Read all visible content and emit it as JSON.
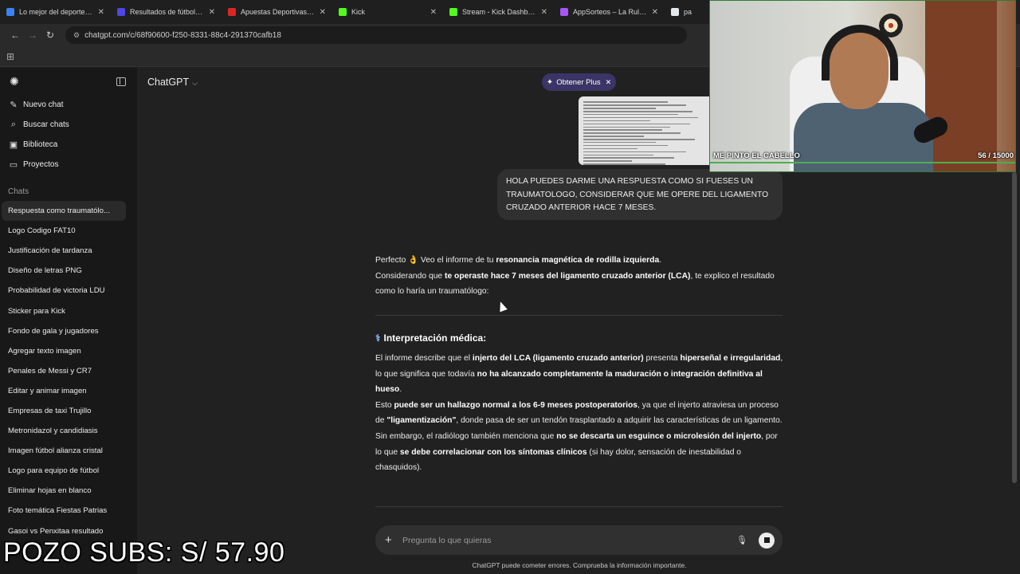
{
  "browser": {
    "tabs": [
      {
        "label": "Lo mejor del deporte y el",
        "favicon_color": "#3b82f6"
      },
      {
        "label": "Resultados de fútbol en d",
        "favicon_color": "#4f46e5"
      },
      {
        "label": "Apuestas Deportivas - Ca",
        "favicon_color": "#dc2626"
      },
      {
        "label": "Kick",
        "favicon_color": "#53fc18"
      },
      {
        "label": "Stream - Kick Dashboard",
        "favicon_color": "#53fc18"
      },
      {
        "label": "AppSorteos – La Ruleta d",
        "favicon_color": "#a855f7"
      },
      {
        "label": "pa",
        "favicon_color": "#e5e7eb"
      }
    ],
    "url": "chatgpt.com/c/68f90600-f250-8331-88c4-291370cafb18"
  },
  "sidebar": {
    "actions": [
      {
        "label": "Nuevo chat",
        "icon": "edit-icon"
      },
      {
        "label": "Buscar chats",
        "icon": "search-icon"
      },
      {
        "label": "Biblioteca",
        "icon": "library-icon"
      },
      {
        "label": "Proyectos",
        "icon": "folder-icon"
      }
    ],
    "section_label": "Chats",
    "chats": [
      "Respuesta como traumatólo...",
      "Logo Codigo FAT10",
      "Justificación de tardanza",
      "Diseño de letras PNG",
      "Probabilidad de victoria LDU",
      "Sticker para Kick",
      "Fondo de gala y jugadores",
      "Agregar texto imagen",
      "Penales de Messi y CR7",
      "Editar y animar imagen",
      "Empresas de taxi Trujillo",
      "Metronidazol y candidiasis",
      "Imagen fútbol alianza cristal",
      "Logo para equipo de fútbol",
      "Eliminar hojas en blanco",
      "Foto temática Fiestas Patrias",
      "Gasoi vs Penxitaa resultado"
    ]
  },
  "header": {
    "model": "ChatGPT",
    "plus_label": "Obtener Plus"
  },
  "conversation": {
    "user_message": "HOLA PUEDES DARME UNA RESPUESTA COMO SI FUESES UN TRAUMATOLOGO, CONSIDERAR QUE ME OPERE DEL LIGAMENTO CRUZADO ANTERIOR HACE 7 MESES.",
    "intro": {
      "p1_a": "Perfecto 👌 Veo el informe de tu ",
      "p1_b": "resonancia magnética de rodilla izquierda",
      "p1_c": ".",
      "p2_a": "Considerando que ",
      "p2_b": "te operaste hace 7 meses del ligamento cruzado anterior (LCA)",
      "p2_c": ", te explico el resultado como lo haría un traumatólogo:"
    },
    "section_title": "Interpretación médica:",
    "section_icon": "stethoscope-icon",
    "body": {
      "a1": "El informe describe que el ",
      "a2": "injerto del LCA (ligamento cruzado anterior)",
      "a3": " presenta ",
      "a4": "hiperseñal e irregularidad",
      "a5": ", lo que significa que todavía ",
      "a6": "no ha alcanzado completamente la maduración o integración definitiva al hueso",
      "a7": ".",
      "b1": "Esto ",
      "b2": "puede ser un hallazgo normal a los 6-9 meses postoperatorios",
      "b3": ", ya que el injerto atraviesa un proceso de ",
      "b4": "\"ligamentización\"",
      "b5": ", donde pasa de ser un tendón trasplantado a adquirir las características de un ligamento.",
      "c1": "Sin embargo, el radiólogo también menciona que ",
      "c2": "no se descarta un esguince o microlesión del injerto",
      "c3": ", por lo que ",
      "c4": "se debe correlacionar con los síntomas clínicos",
      "c5": " (si hay dolor, sensación de inestabilidad o chasquidos)."
    }
  },
  "composer": {
    "placeholder": "Pregunta lo que quieras",
    "disclaimer": "ChatGPT puede cometer errores. Comprueba la información importante."
  },
  "webcam": {
    "goal_label": "ME PINTO EL CABELLO",
    "goal_progress": "56  / 15000"
  },
  "overlay": {
    "pozo": "POZO SUBS: S/ 57.90"
  }
}
